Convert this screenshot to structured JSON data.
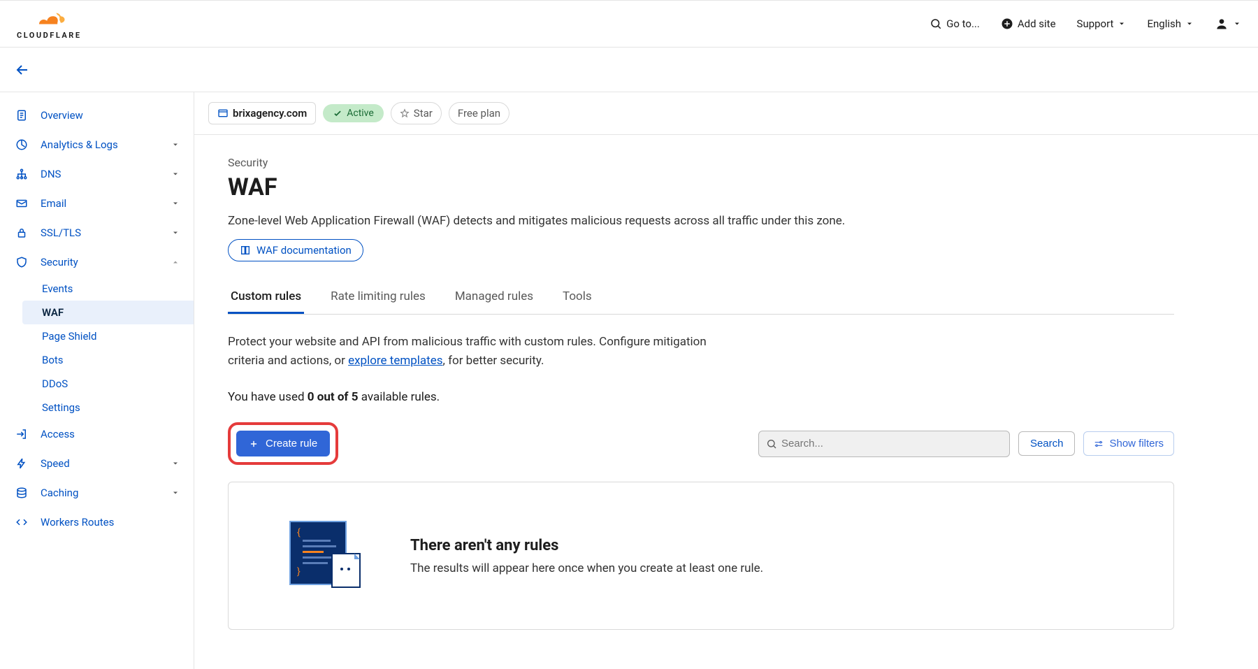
{
  "header": {
    "logo_text": "CLOUDFLARE",
    "goto": "Go to...",
    "add_site": "Add site",
    "support": "Support",
    "language": "English"
  },
  "sidebar": {
    "items": [
      {
        "label": "Overview"
      },
      {
        "label": "Analytics & Logs"
      },
      {
        "label": "DNS"
      },
      {
        "label": "Email"
      },
      {
        "label": "SSL/TLS"
      },
      {
        "label": "Security",
        "children": [
          {
            "label": "Events"
          },
          {
            "label": "WAF",
            "active": true
          },
          {
            "label": "Page Shield"
          },
          {
            "label": "Bots"
          },
          {
            "label": "DDoS"
          },
          {
            "label": "Settings"
          }
        ]
      },
      {
        "label": "Access"
      },
      {
        "label": "Speed"
      },
      {
        "label": "Caching"
      },
      {
        "label": "Workers Routes"
      }
    ]
  },
  "domain_bar": {
    "domain": "brixagency.com",
    "status": "Active",
    "star": "Star",
    "plan": "Free plan"
  },
  "page": {
    "breadcrumb": "Security",
    "title": "WAF",
    "description": "Zone-level Web Application Firewall (WAF) detects and mitigates malicious requests across all traffic under this zone.",
    "doc_link": "WAF documentation",
    "tabs": [
      "Custom rules",
      "Rate limiting rules",
      "Managed rules",
      "Tools"
    ],
    "intro_pre": "Protect your website and API from malicious traffic with custom rules. Configure mitigation criteria and actions, or ",
    "intro_link": "explore templates",
    "intro_post": ", for better security.",
    "usage_pre": "You have used ",
    "usage_bold": "0 out of 5",
    "usage_post": " available rules.",
    "create_btn": "Create rule",
    "search_placeholder": "Search...",
    "search_btn": "Search",
    "filters_btn": "Show filters",
    "empty_title": "There aren't any rules",
    "empty_text": "The results will appear here once when you create at least one rule."
  }
}
